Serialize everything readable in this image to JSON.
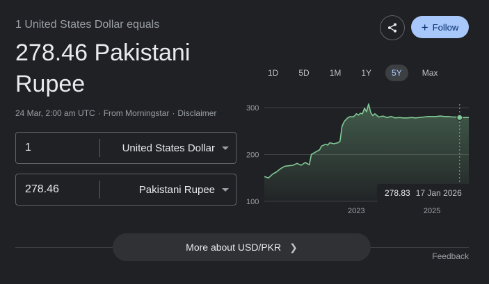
{
  "header": {
    "subtitle": "1 United States Dollar equals",
    "rate_text": "278.46 Pakistani Rupee",
    "timestamp": "24 Mar, 2:00 am UTC",
    "source": "From Morningstar",
    "disclaimer": "Disclaimer",
    "separator": "·"
  },
  "converter": {
    "from": {
      "value": "1",
      "currency": "United States Dollar"
    },
    "to": {
      "value": "278.46",
      "currency": "Pakistani Rupee"
    }
  },
  "actions": {
    "share_icon": "share-icon",
    "follow_label": "Follow",
    "follow_icon": "+"
  },
  "ranges": [
    "1D",
    "5D",
    "1M",
    "1Y",
    "5Y",
    "Max"
  ],
  "active_range": "5Y",
  "tooltip": {
    "value": "278.83",
    "date": "17 Jan 2026"
  },
  "more_label": "More about USD/PKR",
  "feedback_label": "Feedback",
  "colors": {
    "line": "#81c995",
    "accent": "#a8c7fa",
    "background": "#202124"
  },
  "chart_data": {
    "type": "area",
    "yticks": [
      100,
      200,
      300
    ],
    "xticks": [
      "2023",
      "2025"
    ],
    "ylim": [
      100,
      300
    ],
    "grid": true,
    "series": [
      {
        "values": [
          [
            0.0,
            153
          ],
          [
            0.02,
            150
          ],
          [
            0.04,
            158
          ],
          [
            0.06,
            163
          ],
          [
            0.08,
            170
          ],
          [
            0.1,
            175
          ],
          [
            0.12,
            176
          ],
          [
            0.14,
            177
          ],
          [
            0.16,
            181
          ],
          [
            0.18,
            177
          ],
          [
            0.2,
            183
          ],
          [
            0.22,
            178
          ],
          [
            0.23,
            200
          ],
          [
            0.25,
            205
          ],
          [
            0.27,
            210
          ],
          [
            0.28,
            218
          ],
          [
            0.3,
            222
          ],
          [
            0.31,
            220
          ],
          [
            0.32,
            225
          ],
          [
            0.34,
            223
          ],
          [
            0.36,
            225
          ],
          [
            0.37,
            228
          ],
          [
            0.38,
            260
          ],
          [
            0.39,
            270
          ],
          [
            0.4,
            275
          ],
          [
            0.41,
            279
          ],
          [
            0.42,
            281
          ],
          [
            0.43,
            280
          ],
          [
            0.44,
            282
          ],
          [
            0.45,
            287
          ],
          [
            0.46,
            284
          ],
          [
            0.47,
            288
          ],
          [
            0.48,
            287
          ],
          [
            0.49,
            299
          ],
          [
            0.5,
            291
          ],
          [
            0.51,
            308
          ],
          [
            0.52,
            290
          ],
          [
            0.53,
            283
          ],
          [
            0.54,
            287
          ],
          [
            0.56,
            280
          ],
          [
            0.58,
            282
          ],
          [
            0.6,
            279
          ],
          [
            0.62,
            281
          ],
          [
            0.64,
            278
          ],
          [
            0.66,
            279
          ],
          [
            0.68,
            278
          ],
          [
            0.7,
            278
          ],
          [
            0.72,
            279
          ],
          [
            0.74,
            278
          ],
          [
            0.76,
            279
          ],
          [
            0.78,
            280
          ],
          [
            0.8,
            281
          ],
          [
            0.82,
            281
          ],
          [
            0.84,
            281
          ],
          [
            0.86,
            282
          ],
          [
            0.88,
            281
          ],
          [
            0.9,
            281
          ],
          [
            0.92,
            280
          ],
          [
            0.94,
            280
          ],
          [
            0.96,
            279
          ],
          [
            0.98,
            279
          ],
          [
            1.0,
            279
          ]
        ]
      }
    ],
    "highlight": {
      "x": 0.955,
      "y": 278.83
    }
  }
}
